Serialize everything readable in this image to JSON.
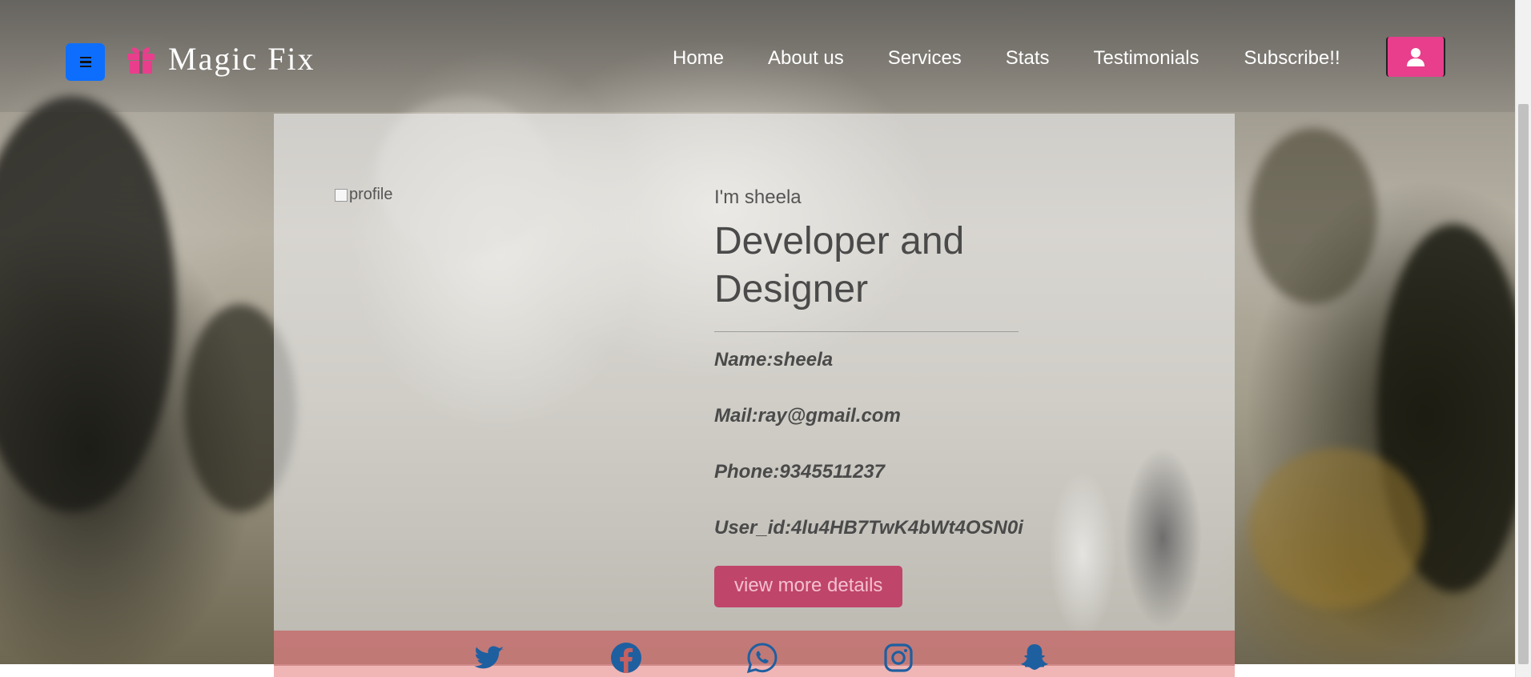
{
  "brand": {
    "name": "Magic Fix",
    "icon": "gift-icon"
  },
  "nav": {
    "items": [
      {
        "label": "Home"
      },
      {
        "label": "About us"
      },
      {
        "label": "Services"
      },
      {
        "label": "Stats"
      },
      {
        "label": "Testimonials"
      },
      {
        "label": "Subscribe!!"
      }
    ],
    "menu_icon": "hamburger-icon",
    "user_icon": "user-icon"
  },
  "profile": {
    "image_alt": "profile",
    "greeting": "I'm sheela",
    "title": "Developer and Designer",
    "name": "Name:sheela",
    "mail": "Mail:ray@gmail.com",
    "phone": "Phone:9345511237",
    "user_id": "User_id:4lu4HB7TwK4bWt4OSN0i",
    "button_label": "view more details"
  },
  "social": [
    "twitter-icon",
    "facebook-icon",
    "whatsapp-icon",
    "instagram-icon",
    "snapchat-icon"
  ],
  "colors": {
    "menu_button": "#0d6efd",
    "accent_pink": "#e83e8c",
    "details_button": "#c0456a",
    "social_icon": "#1e5fa0"
  }
}
